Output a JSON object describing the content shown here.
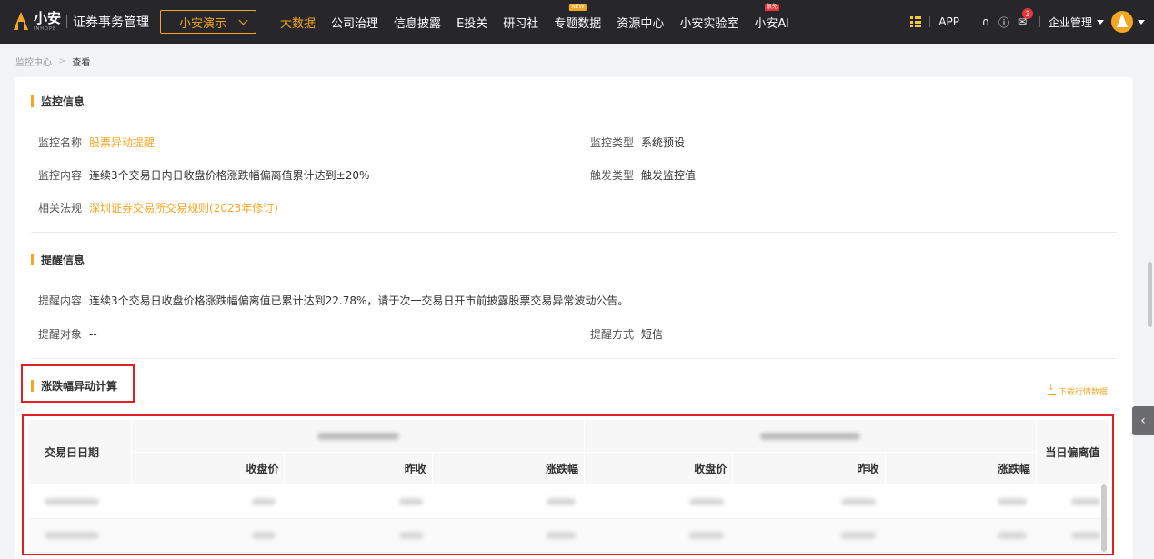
{
  "header": {
    "logo_text": "小安",
    "logo_sub": "INHOPE",
    "app_title": "证券事务管理",
    "org_select": "小安演示",
    "nav": [
      {
        "label": "大数据",
        "active": true,
        "badge": ""
      },
      {
        "label": "公司治理",
        "active": false,
        "badge": ""
      },
      {
        "label": "信息披露",
        "active": false,
        "badge": ""
      },
      {
        "label": "E投关",
        "active": false,
        "badge": ""
      },
      {
        "label": "研习社",
        "active": false,
        "badge": ""
      },
      {
        "label": "专题数据",
        "active": false,
        "badge": "NEW"
      },
      {
        "label": "资源中心",
        "active": false,
        "badge": ""
      },
      {
        "label": "小安实验室",
        "active": false,
        "badge": ""
      },
      {
        "label": "小安AI",
        "active": false,
        "badge": "限免"
      }
    ],
    "app_link": "APP",
    "message_count": "3",
    "user_menu": "企业管理"
  },
  "breadcrumb": {
    "parent": "监控中心",
    "current": "查看"
  },
  "monitor_info": {
    "title": "监控信息",
    "name_label": "监控名称",
    "name_value": "股票异动提醒",
    "type_label": "监控类型",
    "type_value": "系统预设",
    "content_label": "监控内容",
    "content_value": "连续3个交易日内日收盘价格涨跌幅偏离值累计达到±20%",
    "trigger_label": "触发类型",
    "trigger_value": "触发监控值",
    "regulation_label": "相关法规",
    "regulation_value": "深圳证券交易所交易规则(2023年修订)"
  },
  "reminder_info": {
    "title": "提醒信息",
    "content_label": "提醒内容",
    "content_value": "连续3个交易日收盘价格涨跌幅偏离值已累计达到22.78%，请于次一交易日开市前披露股票交易异常波动公告。",
    "target_label": "提醒对象",
    "target_value": "--",
    "method_label": "提醒方式",
    "method_value": "短信"
  },
  "calc": {
    "title": "涨跌幅异动计算",
    "download_label": "下载行情数据",
    "table": {
      "col_date": "交易日日期",
      "col_close": "收盘价",
      "col_prev": "昨收",
      "col_change": "涨跌幅",
      "col_dev": "当日偏离值"
    }
  }
}
